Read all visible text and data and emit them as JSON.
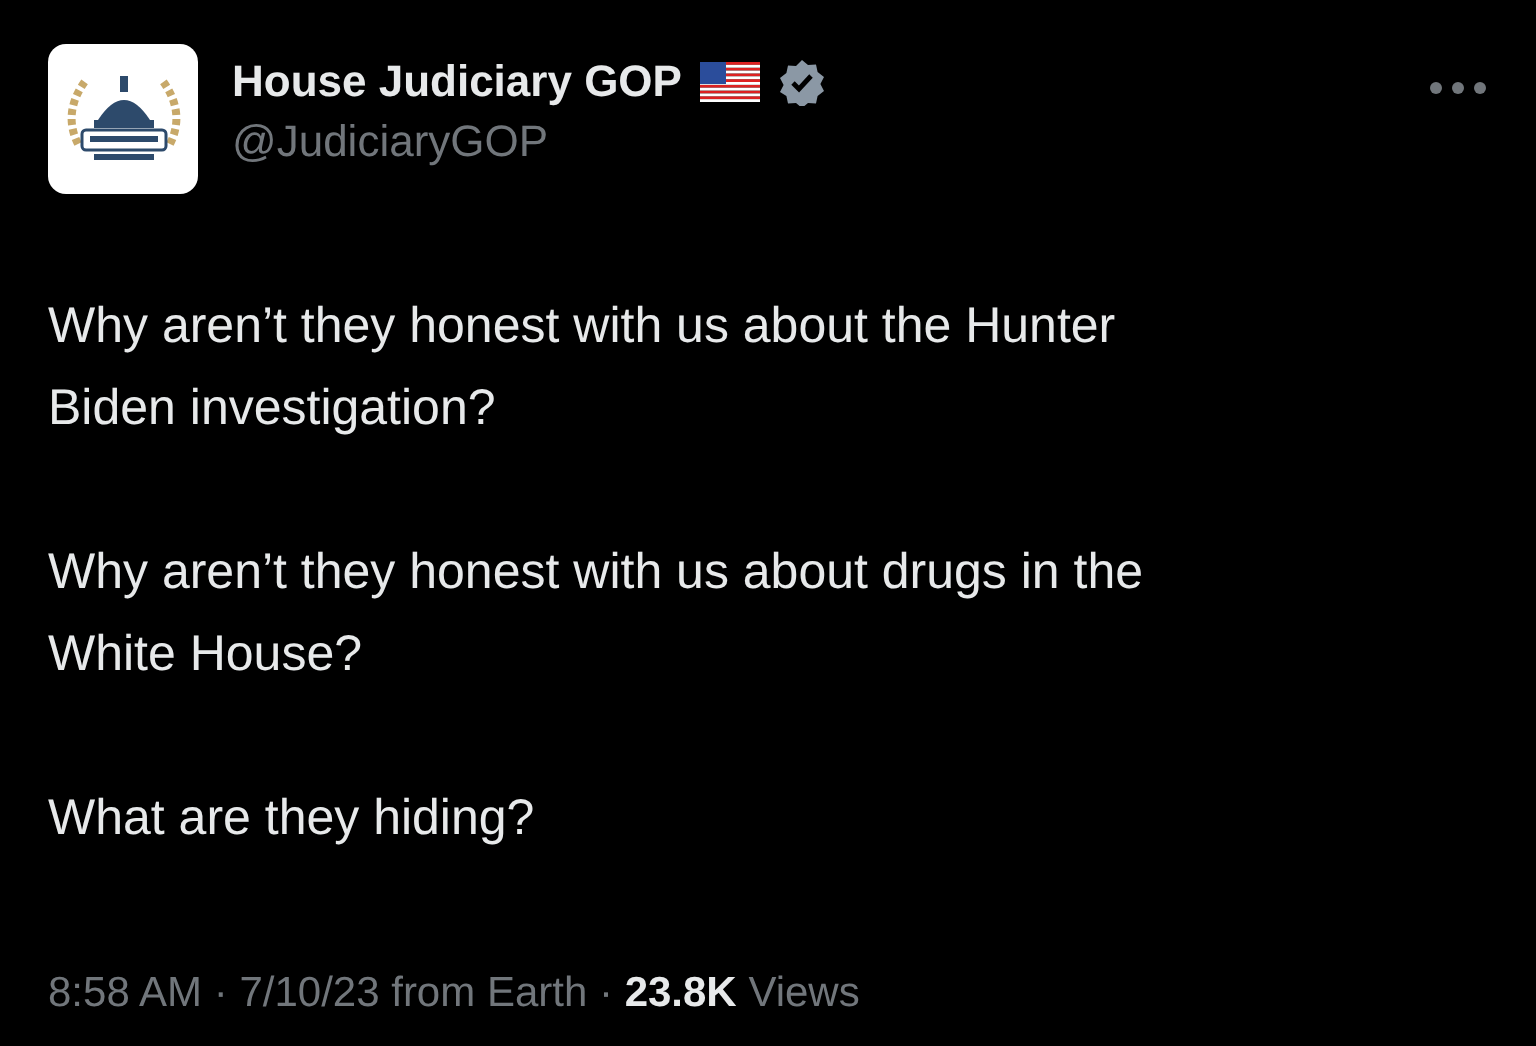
{
  "author": {
    "name": "House Judiciary GOP",
    "handle": "@JudiciaryGOP",
    "verified": true
  },
  "body": [
    [
      "Why aren’t they honest with us about the Hunter",
      "Biden investigation?"
    ],
    [
      "Why aren’t they honest with us about drugs in the",
      "White House?"
    ],
    [
      "What are they hiding?"
    ]
  ],
  "meta": "8:58 AM · 7/10/23 from Earth · **23.8K** Views"
}
